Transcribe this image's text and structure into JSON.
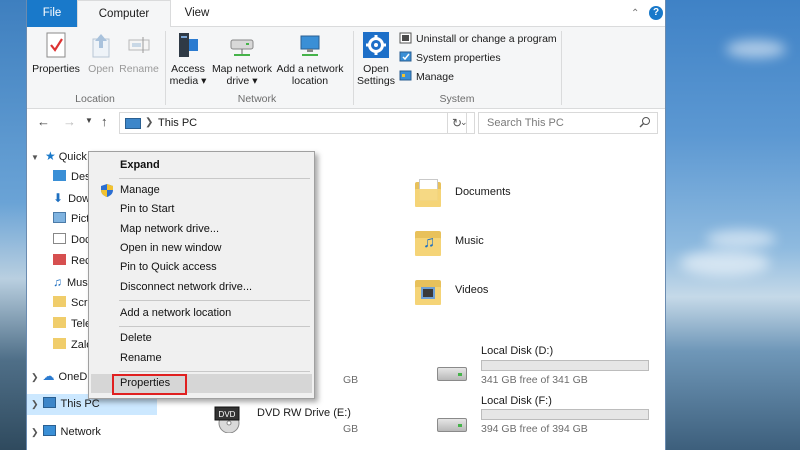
{
  "ribbon": {
    "tabs": {
      "file": "File",
      "computer": "Computer",
      "view": "View"
    },
    "help_icon": "help-icon",
    "location": {
      "label": "Location",
      "properties": "Properties",
      "open": "Open",
      "rename": "Rename"
    },
    "network": {
      "label": "Network",
      "access_media_line1": "Access",
      "access_media_line2": "media ▾",
      "map_drive_line1": "Map network",
      "map_drive_line2": "drive ▾",
      "add_location_line1": "Add a network",
      "add_location_line2": "location"
    },
    "system": {
      "label": "System",
      "open_settings_line1": "Open",
      "open_settings_line2": "Settings",
      "uninstall": "Uninstall or change a program",
      "system_properties": "System properties",
      "manage": "Manage"
    }
  },
  "address_bar": {
    "path": "This PC",
    "search_placeholder": "Search This PC"
  },
  "nav_pane": {
    "items": [
      {
        "label": "Quick access"
      },
      {
        "label": "Desktop"
      },
      {
        "label": "Downloads"
      },
      {
        "label": "Pictures"
      },
      {
        "label": "Documents"
      },
      {
        "label": "Recordings"
      },
      {
        "label": "Music"
      },
      {
        "label": "Screenshots"
      },
      {
        "label": "Telegram"
      },
      {
        "label": "Zalo"
      },
      {
        "label": "OneDrive"
      },
      {
        "label": "This PC"
      },
      {
        "label": "Network"
      }
    ]
  },
  "folders": [
    {
      "label": "Documents"
    },
    {
      "label": "Music"
    },
    {
      "label": "Videos"
    }
  ],
  "drives": [
    {
      "label": "Local Disk (D:)",
      "free": "341 GB free of 341 GB",
      "used_fraction": 0.0
    },
    {
      "label": "Local Disk (F:)",
      "free": "394 GB free of 394 GB",
      "used_fraction": 0.0
    },
    {
      "label": "DVD RW Drive (E:)",
      "free": ""
    },
    {
      "partial_free": "GB"
    },
    {
      "partial_free": "GB"
    }
  ],
  "context_menu": {
    "items": [
      "Expand",
      "Manage",
      "Pin to Start",
      "Map network drive...",
      "Open in new window",
      "Pin to Quick access",
      "Disconnect network drive...",
      "Add a network location",
      "Delete",
      "Rename",
      "Properties"
    ]
  },
  "colors": {
    "file_tab": "#1979ca",
    "highlight_box": "#e02020",
    "capacity_bar": "#26a0da"
  }
}
